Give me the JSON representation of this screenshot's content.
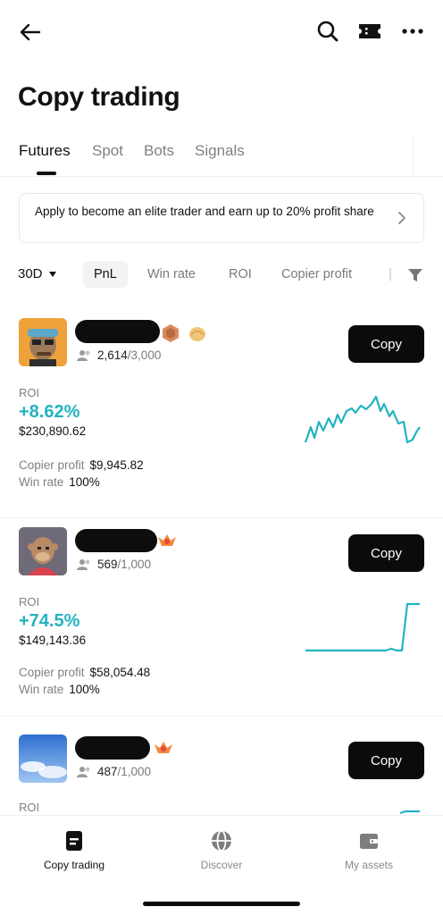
{
  "header": {
    "title": "Copy trading",
    "icons": [
      "back-arrow-icon",
      "search-icon",
      "ticket-icon",
      "more-icon"
    ]
  },
  "tabs": [
    {
      "label": "Futures",
      "active": true
    },
    {
      "label": "Spot",
      "active": false
    },
    {
      "label": "Bots",
      "active": false
    },
    {
      "label": "Signals",
      "active": false
    }
  ],
  "banner": {
    "text": "Apply to become an elite trader and earn up to 20% profit share"
  },
  "filters": {
    "period": "30D",
    "options": [
      {
        "label": "PnL",
        "active": true
      },
      {
        "label": "Win rate",
        "active": false
      },
      {
        "label": "ROI",
        "active": false
      },
      {
        "label": "Copier profit",
        "active": false
      }
    ]
  },
  "traders": [
    {
      "copiers": "2,614",
      "copiers_max": "/3,000",
      "copy_label": "Copy",
      "roi_label": "ROI",
      "roi": "+8.62%",
      "pnl": "$230,890.62",
      "copier_profit_label": "Copier profit",
      "copier_profit": "$9,945.82",
      "win_rate_label": "Win rate",
      "win_rate": "100%"
    },
    {
      "copiers": "569",
      "copiers_max": "/1,000",
      "copy_label": "Copy",
      "roi_label": "ROI",
      "roi": "+74.5%",
      "pnl": "$149,143.36",
      "copier_profit_label": "Copier profit",
      "copier_profit": "$58,054.48",
      "win_rate_label": "Win rate",
      "win_rate": "100%"
    },
    {
      "copiers": "487",
      "copiers_max": "/1,000",
      "copy_label": "Copy",
      "roi_label": "ROI"
    }
  ],
  "bottom_nav": [
    {
      "label": "Copy trading",
      "icon": "document-icon",
      "active": true
    },
    {
      "label": "Discover",
      "icon": "globe-icon",
      "active": false
    },
    {
      "label": "My assets",
      "icon": "wallet-icon",
      "active": false
    }
  ],
  "colors": {
    "accent": "#22b3c2",
    "primary_button": "#0b0b0b"
  }
}
